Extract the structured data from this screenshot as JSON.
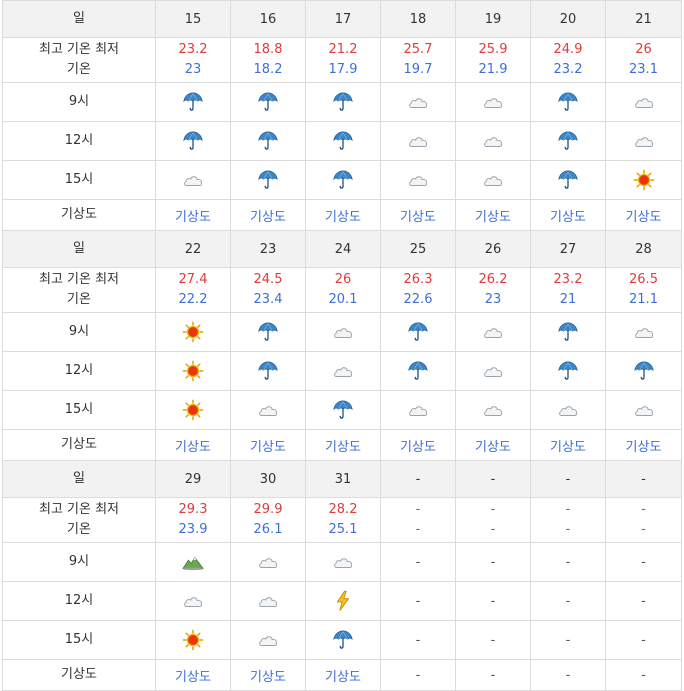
{
  "labels": {
    "day": "일",
    "temp_line1": "최고 기온 최저",
    "temp_line2": "기온",
    "h9": "9시",
    "h12": "12시",
    "h15": "15시",
    "map": "기상도"
  },
  "weeks": [
    {
      "days": [
        {
          "date": "15",
          "high": "23.2",
          "low": "23",
          "h9": "umbrella",
          "h12": "umbrella",
          "h15": "cloud",
          "map": "기상도"
        },
        {
          "date": "16",
          "high": "18.8",
          "low": "18.2",
          "h9": "umbrella",
          "h12": "umbrella",
          "h15": "umbrella",
          "map": "기상도"
        },
        {
          "date": "17",
          "high": "21.2",
          "low": "17.9",
          "h9": "umbrella",
          "h12": "umbrella",
          "h15": "umbrella",
          "map": "기상도"
        },
        {
          "date": "18",
          "high": "25.7",
          "low": "19.7",
          "h9": "cloud",
          "h12": "cloud",
          "h15": "cloud",
          "map": "기상도"
        },
        {
          "date": "19",
          "high": "25.9",
          "low": "21.9",
          "h9": "cloud",
          "h12": "cloud",
          "h15": "cloud",
          "map": "기상도"
        },
        {
          "date": "20",
          "high": "24.9",
          "low": "23.2",
          "h9": "umbrella",
          "h12": "umbrella",
          "h15": "umbrella",
          "map": "기상도"
        },
        {
          "date": "21",
          "high": "26",
          "low": "23.1",
          "h9": "cloud",
          "h12": "cloud",
          "h15": "sun",
          "map": "기상도"
        }
      ]
    },
    {
      "days": [
        {
          "date": "22",
          "high": "27.4",
          "low": "22.2",
          "h9": "sun",
          "h12": "sun",
          "h15": "sun",
          "map": "기상도"
        },
        {
          "date": "23",
          "high": "24.5",
          "low": "23.4",
          "h9": "umbrella",
          "h12": "umbrella",
          "h15": "cloud",
          "map": "기상도"
        },
        {
          "date": "24",
          "high": "26",
          "low": "20.1",
          "h9": "cloud",
          "h12": "cloud",
          "h15": "umbrella",
          "map": "기상도"
        },
        {
          "date": "25",
          "high": "26.3",
          "low": "22.6",
          "h9": "umbrella",
          "h12": "umbrella",
          "h15": "cloud",
          "map": "기상도"
        },
        {
          "date": "26",
          "high": "26.2",
          "low": "23",
          "h9": "cloud",
          "h12": "cloud",
          "h15": "cloud",
          "map": "기상도"
        },
        {
          "date": "27",
          "high": "23.2",
          "low": "21",
          "h9": "umbrella",
          "h12": "umbrella",
          "h15": "cloud",
          "map": "기상도"
        },
        {
          "date": "28",
          "high": "26.5",
          "low": "21.1",
          "h9": "cloud",
          "h12": "umbrella",
          "h15": "cloud",
          "map": "기상도"
        }
      ]
    },
    {
      "days": [
        {
          "date": "29",
          "high": "29.3",
          "low": "23.9",
          "h9": "mountain",
          "h12": "cloud",
          "h15": "sun",
          "map": "기상도"
        },
        {
          "date": "30",
          "high": "29.9",
          "low": "26.1",
          "h9": "cloud",
          "h12": "cloud",
          "h15": "cloud",
          "map": "기상도"
        },
        {
          "date": "31",
          "high": "28.2",
          "low": "25.1",
          "h9": "cloud",
          "h12": "lightning",
          "h15": "umbrella",
          "map": "기상도"
        },
        {
          "date": "-",
          "high": "-",
          "low": "-",
          "h9": "-",
          "h12": "-",
          "h15": "-",
          "map": "-"
        },
        {
          "date": "-",
          "high": "-",
          "low": "-",
          "h9": "-",
          "h12": "-",
          "h15": "-",
          "map": "-"
        },
        {
          "date": "-",
          "high": "-",
          "low": "-",
          "h9": "-",
          "h12": "-",
          "h15": "-",
          "map": "-"
        },
        {
          "date": "-",
          "high": "-",
          "low": "-",
          "h9": "-",
          "h12": "-",
          "h15": "-",
          "map": "-"
        }
      ]
    }
  ],
  "colors": {
    "high": "#e03b3b",
    "low": "#3d6fd6",
    "link": "#3d6fd6",
    "header_bg": "#f2f2f2",
    "border": "#dcdcdc"
  }
}
